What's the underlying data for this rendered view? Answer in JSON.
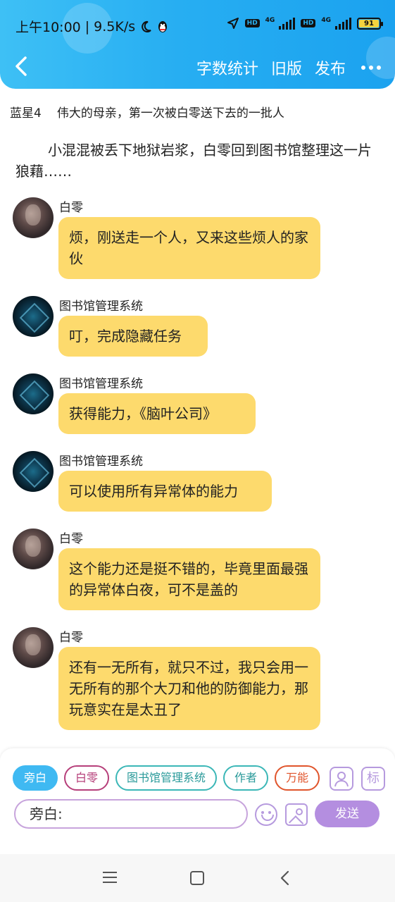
{
  "status_bar": {
    "time": "上午10:00",
    "separator": "|",
    "net_speed": "9.5K/s",
    "network_1": "4G",
    "network_2": "4G",
    "hd_badge": "HD",
    "battery": "91"
  },
  "header": {
    "actions": [
      "字数统计",
      "旧版",
      "发布"
    ]
  },
  "story": {
    "title_left": "蓝星4",
    "title_right": "伟大的母亲，第一次被白零送下去的一批人",
    "intro": "小混混被丢下地狱岩浆，白零回到图书馆整理这一片狼藉……"
  },
  "messages": [
    {
      "speaker": "白零",
      "text": "烦，刚送走一个人，又来这些烦人的家伙"
    },
    {
      "speaker": "图书馆管理系统",
      "text": "叮，完成隐藏任务"
    },
    {
      "speaker": "图书馆管理系统",
      "text": "获得能力，《脑叶公司》"
    },
    {
      "speaker": "图书馆管理系统",
      "text": "可以使用所有异常体的能力"
    },
    {
      "speaker": "白零",
      "text": "这个能力还是挺不错的，毕竟里面最强的异常体白夜，可不是盖的"
    },
    {
      "speaker": "白零",
      "text": "还有一无所有，就只不过，我只会用一无所有的那个大刀和他的防御能力，那玩意实在是太丑了"
    }
  ],
  "composer": {
    "roles": [
      "旁白",
      "白零",
      "图书馆管理系统",
      "作者",
      "万能"
    ],
    "user_icon": "person-icon",
    "tag_label": "标",
    "input_value": "旁白:",
    "send_label": "发送"
  },
  "colors": {
    "header_blue": "#27aef2",
    "bubble_yellow": "#fdda6d",
    "accent_purple": "#b48ee0"
  }
}
